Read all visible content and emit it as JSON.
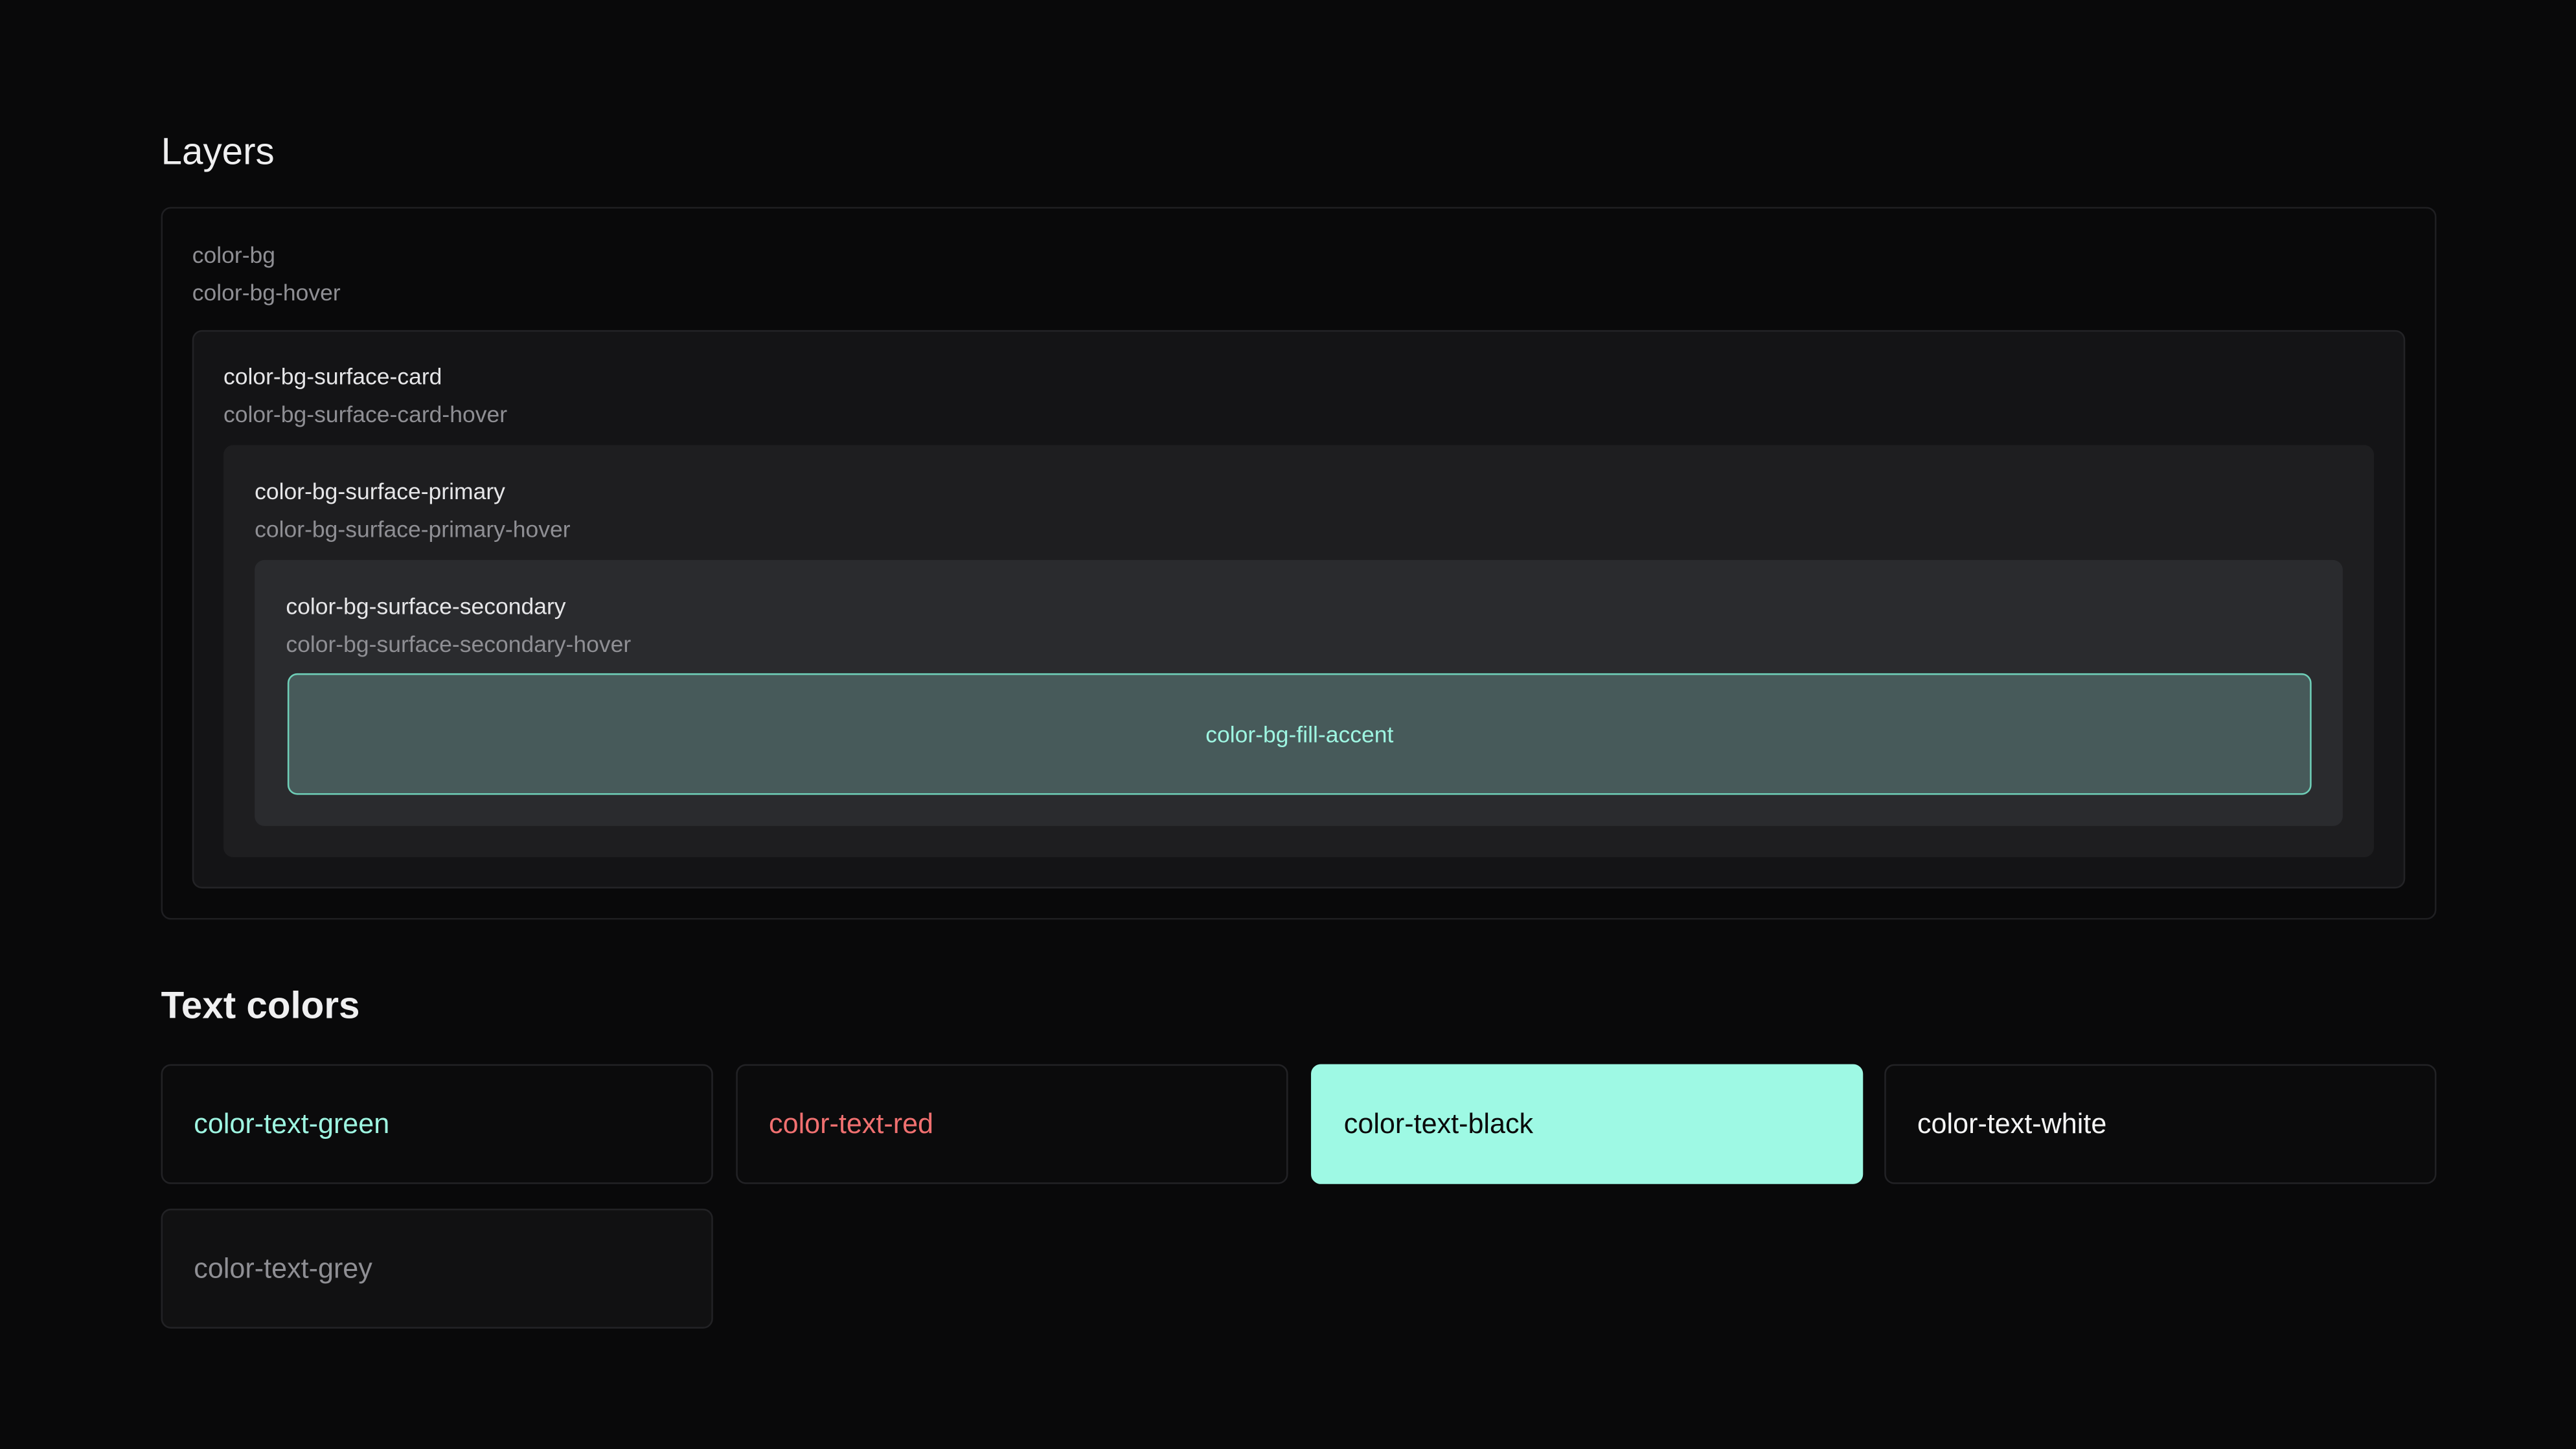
{
  "layers": {
    "heading": "Layers",
    "bg": {
      "name": "color-bg",
      "hover": "color-bg-hover"
    },
    "card": {
      "name": "color-bg-surface-card",
      "hover": "color-bg-surface-card-hover"
    },
    "primary": {
      "name": "color-bg-surface-primary",
      "hover": "color-bg-surface-primary-hover"
    },
    "secondary": {
      "name": "color-bg-surface-secondary",
      "hover": "color-bg-surface-secondary-hover"
    },
    "accent": {
      "name": "color-bg-fill-accent"
    }
  },
  "text_colors": {
    "heading": "Text colors",
    "items": [
      {
        "name": "color-text-green",
        "color": "#9ef5e1",
        "background": "#0b0b0c"
      },
      {
        "name": "color-text-red",
        "color": "#f07070",
        "background": "#0b0b0c"
      },
      {
        "name": "color-text-black",
        "color": "#0a0a0a",
        "background": "#9ef9e4"
      },
      {
        "name": "color-text-white",
        "color": "#f5f5f5",
        "background": "#0b0b0c"
      },
      {
        "name": "color-text-grey",
        "color": "#8f8f94",
        "background": "#111112"
      }
    ]
  },
  "colors": {
    "bg": "#09090a",
    "surface_card": "#141416",
    "surface_primary": "#1e1e20",
    "surface_secondary": "#2a2b2e",
    "fill_accent": "#475a5a",
    "accent_border": "#6fcfb8"
  }
}
